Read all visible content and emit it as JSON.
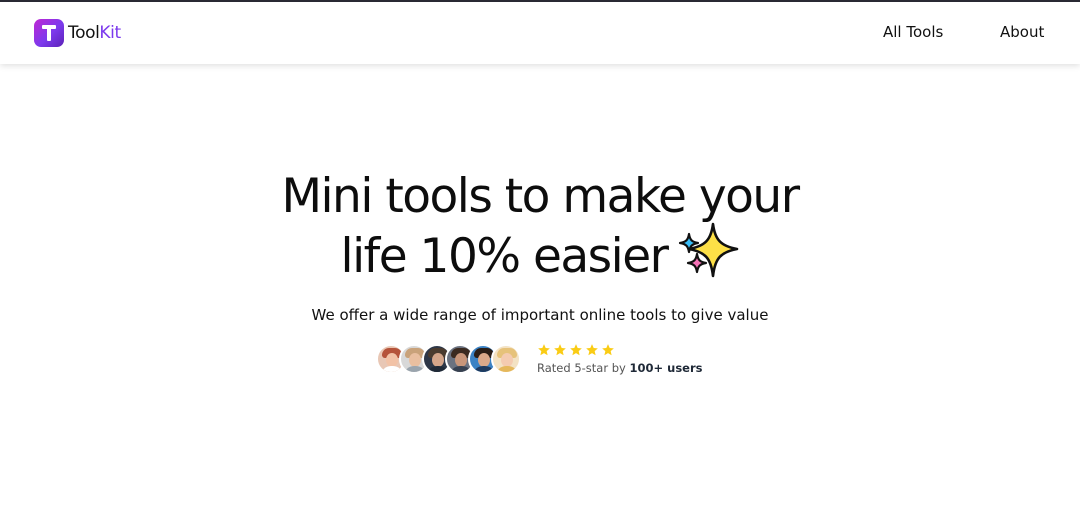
{
  "header": {
    "brand": {
      "name_part1": "Tool",
      "name_part2": "Kit",
      "logo_letter": "T",
      "logo_icon": "toolkit-logo-icon"
    },
    "nav": {
      "all_tools_label": "All Tools",
      "about_label": "About"
    }
  },
  "hero": {
    "title_line1": "Mini tools to make your",
    "title_line2": "life 10% easier",
    "title_icon": "sparkles-icon",
    "subtitle": "We offer a wide range of important online tools to give value"
  },
  "social_proof": {
    "avatar_count": 6,
    "star_rating": 5,
    "star_icon": "star-icon",
    "rating_prefix": "Rated 5-star by ",
    "rating_highlight": "100+ users"
  },
  "colors": {
    "brand_accent": "#7c3aed",
    "brand_gradient_start": "#c026d3",
    "star": "#facc15",
    "sparkle_main": "#fde047",
    "sparkle_blue": "#38bdf8",
    "sparkle_pink": "#f472b6"
  }
}
